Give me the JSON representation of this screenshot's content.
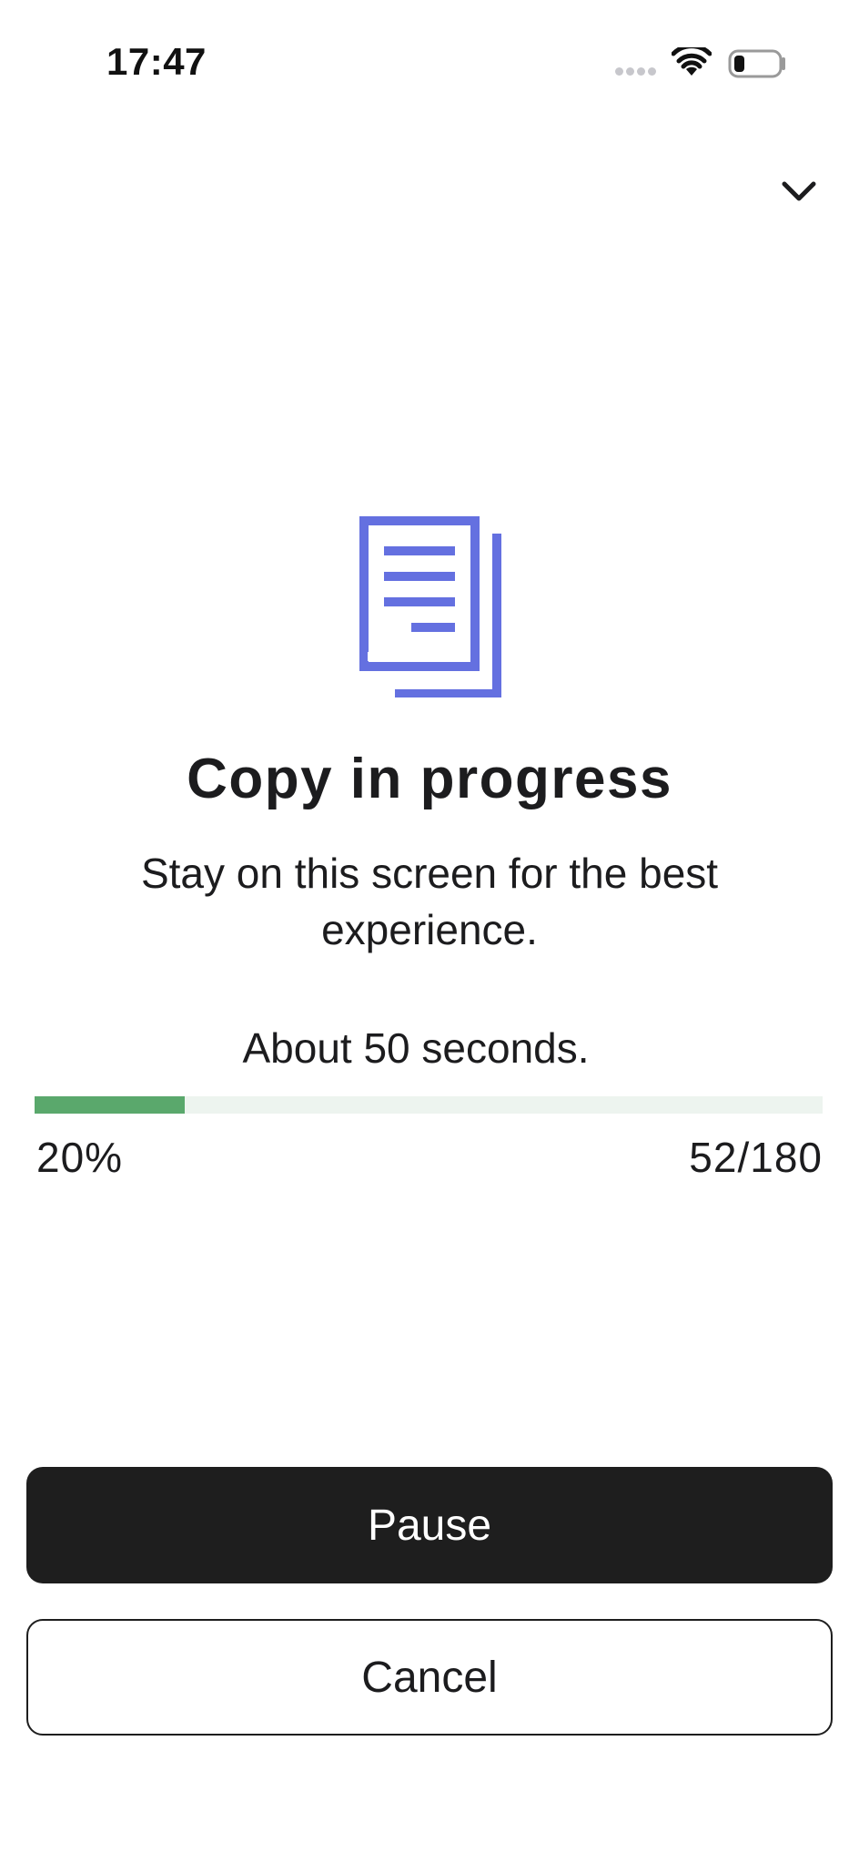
{
  "status_bar": {
    "time": "17:47",
    "icons": [
      "signal-dots-icon",
      "wifi-icon",
      "battery-icon"
    ]
  },
  "header": {
    "collapse_icon": "chevron-down-icon"
  },
  "main": {
    "icon": "document-copy-icon",
    "title": "Copy in progress",
    "subtitle": "Stay on this screen for the best experience.",
    "eta": "About 50 seconds.",
    "progress": {
      "percent_label": "20%",
      "count_label": "52/180",
      "fraction": 0.19
    }
  },
  "actions": {
    "pause_label": "Pause",
    "cancel_label": "Cancel"
  },
  "colors": {
    "accent_icon": "#6470e0",
    "progress_fill": "#5aa86c",
    "progress_track": "#edf4ef",
    "primary_button": "#1e1e1e"
  }
}
